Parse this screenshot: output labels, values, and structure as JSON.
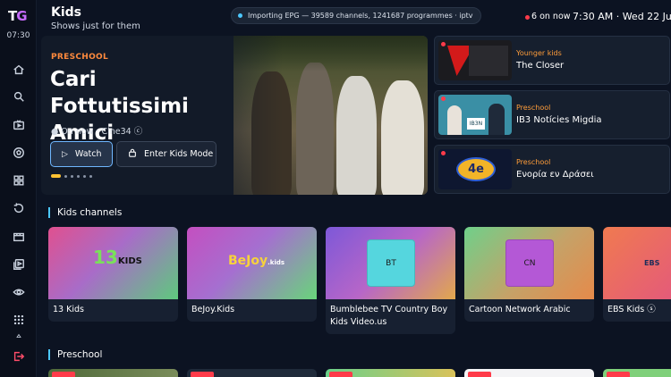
{
  "rail": {
    "logo_t": "T",
    "logo_g": "G",
    "time": "07:30",
    "items": [
      {
        "name": "home-icon"
      },
      {
        "name": "search-icon"
      },
      {
        "name": "live-tv-icon"
      },
      {
        "name": "sports-icon"
      },
      {
        "name": "grid-icon"
      },
      {
        "name": "history-icon"
      },
      {
        "name": "movies-icon"
      },
      {
        "name": "library-icon"
      },
      {
        "name": "eye-icon"
      },
      {
        "name": "apps-icon"
      },
      {
        "name": "small-up-icon"
      },
      {
        "name": "logout-icon"
      }
    ]
  },
  "header": {
    "title": "Kids",
    "subtitle": "Shows just for them",
    "epg_status": "Importing EPG — 39589 channels, 1241687 programmes · iptv",
    "now_count": "6 on now",
    "clock": "7:30 AM · Wed 22 Jul"
  },
  "hero": {
    "kicker": "PRESCHOOL",
    "title": "Cari Fottutissimi Amici",
    "meta": "● On now · Cine34 ⓒ",
    "watch_label": "Watch",
    "kids_mode_label": "Enter Kids Mode",
    "carousel_active": 1,
    "carousel_total": 6
  },
  "side_list": [
    {
      "category": "Younger kids",
      "name": "The Closer"
    },
    {
      "category": "Preschool",
      "name": "IB3 Notícies Migdia"
    },
    {
      "category": "Preschool",
      "name": "Ενορία εν Δράσει"
    }
  ],
  "sections": {
    "kids_channels": "Kids channels",
    "preschool": "Preschool"
  },
  "channels": [
    {
      "logo": "13KIDS",
      "label": "13 Kids"
    },
    {
      "logo": "BeJoy.Kids",
      "label": "BeJoy.Kids"
    },
    {
      "logo": "BT",
      "label": "Bumblebee TV Country Boy Kids Video.us"
    },
    {
      "logo": "CN",
      "label": "Cartoon Network Arabic"
    },
    {
      "logo": "EBS",
      "label": "EBS Kids ⓢ"
    }
  ],
  "colors": {
    "accent": "#4cc8ff",
    "live": "#ff3b4a",
    "category": "#ff9d3a",
    "carousel_active": "#ffc233"
  }
}
